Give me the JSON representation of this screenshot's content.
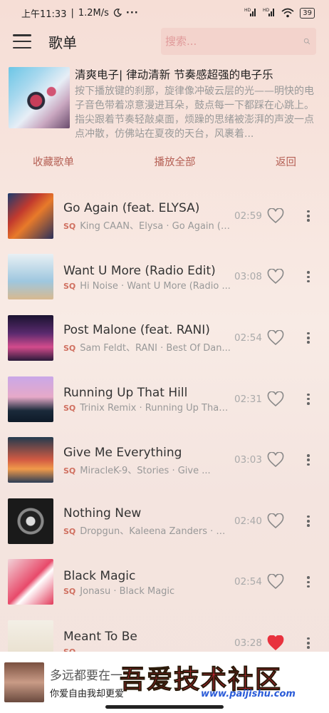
{
  "status_bar": {
    "time": "上午11:33",
    "speed": "1.2M/s",
    "moon_icon": "moon-icon",
    "more": "···",
    "signal1": "HD",
    "signal2": "HD",
    "battery": "39"
  },
  "header": {
    "title": "歌单",
    "search_placeholder": "搜索..."
  },
  "playlist": {
    "title": "清爽电子| 律动清新 节奏感超强的电子乐",
    "description": "按下播放键的刹那，旋律像冲破云层的光——明快的电子音色带着凉意漫进耳朵，鼓点每一下都踩在心跳上。指尖跟着节奏轻敲桌面，烦躁的思绪被澎湃的声波一点点冲散，仿佛站在夏夜的天台，风裹着..."
  },
  "actions": {
    "collect": "收藏歌单",
    "play_all": "播放全部",
    "back": "返回"
  },
  "songs": [
    {
      "title": "Go Again (feat. ELYSA)",
      "quality": "SQ",
      "meta": "King CAAN、Elysa · Go Again (f...",
      "duration": "02:59",
      "liked": false
    },
    {
      "title": "Want U More (Radio Edit)",
      "quality": "SQ",
      "meta": "Hi Noise · Want U More (Radio ...",
      "duration": "03:08",
      "liked": false
    },
    {
      "title": "Post Malone (feat. RANI)",
      "quality": "SQ",
      "meta": "Sam Feldt、RANI · Best Of Dan...",
      "duration": "02:54",
      "liked": false
    },
    {
      "title": "Running Up That Hill",
      "quality": "SQ",
      "meta": "Trinix Remix · Running Up That ...",
      "duration": "02:31",
      "liked": false
    },
    {
      "title": "Give Me Everything",
      "quality": "SQ",
      "meta": "MiracleK-9、Stories · Give ...",
      "duration": "03:03",
      "liked": false
    },
    {
      "title": "Nothing New",
      "quality": "SQ",
      "meta": "Dropgun、Kaleena Zanders · N...",
      "duration": "02:40",
      "liked": false
    },
    {
      "title": "Black Magic",
      "quality": "SQ",
      "meta": "Jonasu · Black Magic",
      "duration": "02:54",
      "liked": false
    },
    {
      "title": "Meant To Be",
      "quality": "SQ",
      "meta": "",
      "duration": "03:28",
      "liked": true
    }
  ],
  "mini_player": {
    "title": "多远都要在一",
    "subtitle": "你爱自由我却更爱"
  },
  "watermark": {
    "text": "吾爱技术社区",
    "url": "www.paijishu.com"
  },
  "colors": {
    "accent": "#b56055",
    "liked": "#e8323e",
    "sq": "#d07060"
  }
}
